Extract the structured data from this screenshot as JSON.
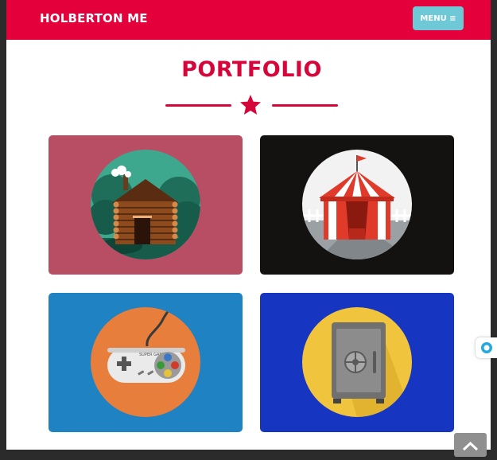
{
  "navbar": {
    "brand": "HOLBERTON ME",
    "menu_label": "MENU ≡"
  },
  "portfolio": {
    "title": "PORTFOLIO",
    "items": [
      {
        "name": "cabin",
        "icon": "log-cabin-icon",
        "bg": "#b84e63"
      },
      {
        "name": "circus",
        "icon": "circus-tent-icon",
        "bg": "#141111"
      },
      {
        "name": "controller",
        "icon": "game-controller-icon",
        "bg": "#1f82c2"
      },
      {
        "name": "safe",
        "icon": "safe-icon",
        "bg": "#1636c1"
      }
    ]
  },
  "controller": {
    "brand_text": "SUPER GAME"
  },
  "colors": {
    "accent": "#e4003a",
    "title": "#d7063a",
    "menu": "#6ec8d6"
  }
}
